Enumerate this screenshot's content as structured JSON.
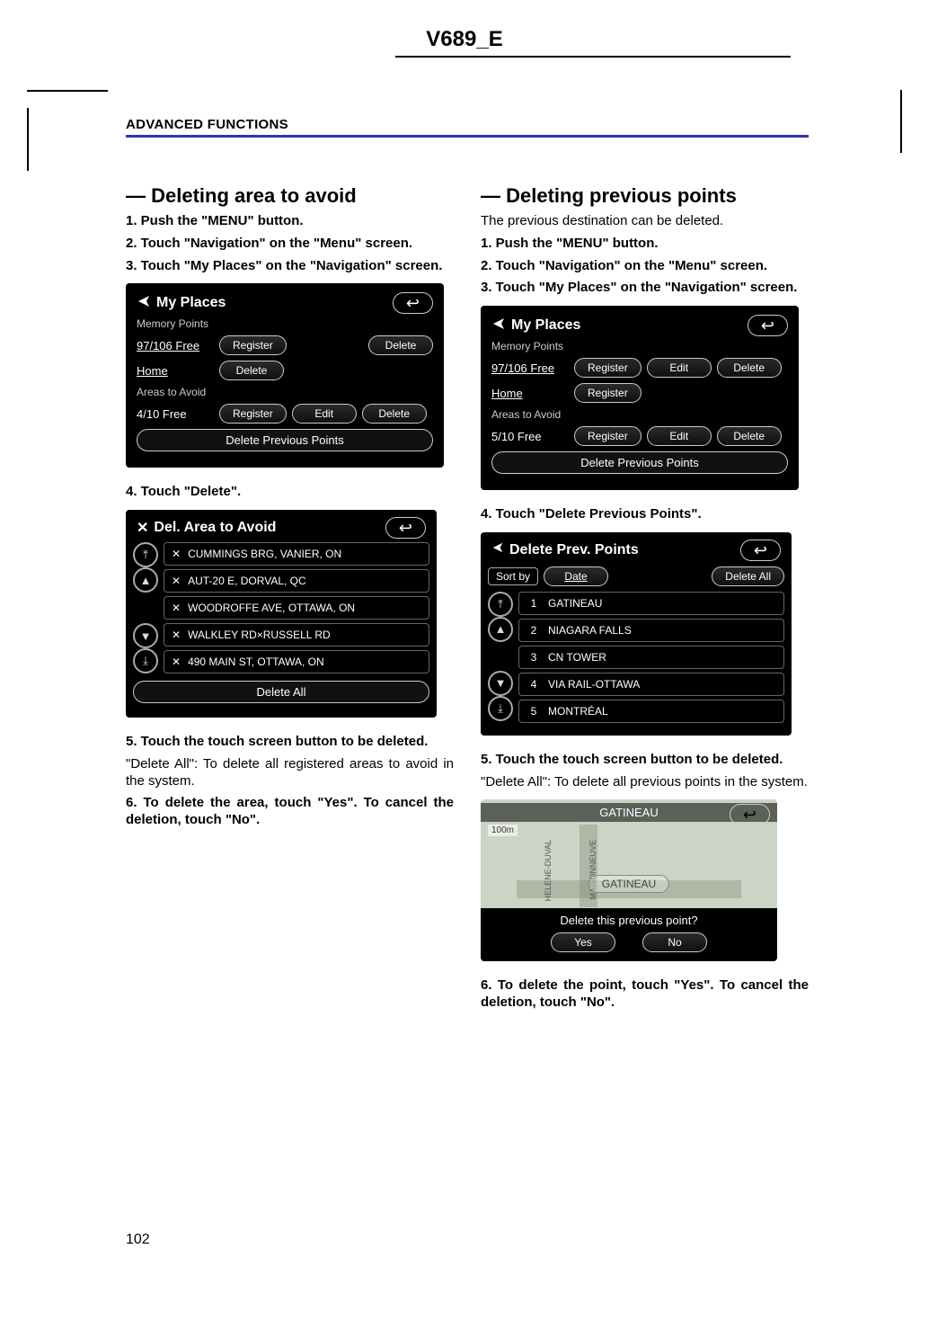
{
  "doc_header": "V689_E",
  "section_header": "ADVANCED FUNCTIONS",
  "page_number": "102",
  "left": {
    "title": "— Deleting area to avoid",
    "step1": "1.  Push the \"MENU\" button.",
    "step2": "2.  Touch \"Navigation\" on the \"Menu\" screen.",
    "step3": "3.  Touch \"My Places\" on the \"Navigation\" screen.",
    "step4": "4.  Touch \"Delete\".",
    "step5": "5.  Touch the touch screen button to be deleted.",
    "delete_all_note": "\"Delete All\": To delete all registered areas to avoid in the system.",
    "step6": "6.  To delete the area, touch \"Yes\". To cancel the deletion, touch \"No\".",
    "myplaces": {
      "title": "My Places",
      "subtitle": "Memory Points",
      "row1_label": "97/106 Free",
      "register": "Register",
      "delete": "Delete",
      "home_label": "Home",
      "areas_label": "Areas to Avoid",
      "row3_label": "4/10 Free",
      "edit": "Edit",
      "delete_prev": "Delete Previous Points"
    },
    "delarea": {
      "title": "Del. Area to Avoid",
      "items": [
        "CUMMINGS BRG, VANIER, ON",
        "AUT-20 E, DORVAL, QC",
        "WOODROFFE AVE, OTTAWA, ON",
        "WALKLEY RD×RUSSELL RD",
        "490 MAIN ST, OTTAWA, ON"
      ],
      "delete_all": "Delete All"
    }
  },
  "right": {
    "title": "— Deleting previous points",
    "intro": "The previous destination can be deleted.",
    "step1": "1.  Push the \"MENU\" button.",
    "step2": "2.  Touch \"Navigation\" on the \"Menu\" screen.",
    "step3": "3.  Touch \"My Places\" on the \"Navigation\" screen.",
    "step4": "4.  Touch \"Delete Previous Points\".",
    "step5": "5.  Touch the touch screen button to be deleted.",
    "delete_all_note": "\"Delete All\": To delete all previous points in the system.",
    "step6": "6.  To delete the point, touch \"Yes\". To cancel the deletion, touch \"No\".",
    "myplaces": {
      "title": "My Places",
      "subtitle": "Memory Points",
      "row1_label": "97/106 Free",
      "register": "Register",
      "edit": "Edit",
      "delete": "Delete",
      "home_label": "Home",
      "areas_label": "Areas to Avoid",
      "row3_label": "5/10 Free",
      "delete_prev": "Delete Previous Points"
    },
    "delprev": {
      "title": "Delete Prev. Points",
      "sortby": "Sort by",
      "date": "Date",
      "delete_all": "Delete All",
      "items": [
        {
          "n": "1",
          "t": "GATINEAU"
        },
        {
          "n": "2",
          "t": "NIAGARA FALLS"
        },
        {
          "n": "3",
          "t": "CN TOWER"
        },
        {
          "n": "4",
          "t": "VIA RAIL-OTTAWA"
        },
        {
          "n": "5",
          "t": "MONTRÉAL"
        }
      ]
    },
    "map": {
      "top": "GATINEAU",
      "scale": "100m",
      "street1": "HELENE-DUVAL",
      "street2": "MAISONNEUVE",
      "center": "GATINEAU",
      "question": "Delete this previous point?",
      "yes": "Yes",
      "no": "No"
    }
  }
}
